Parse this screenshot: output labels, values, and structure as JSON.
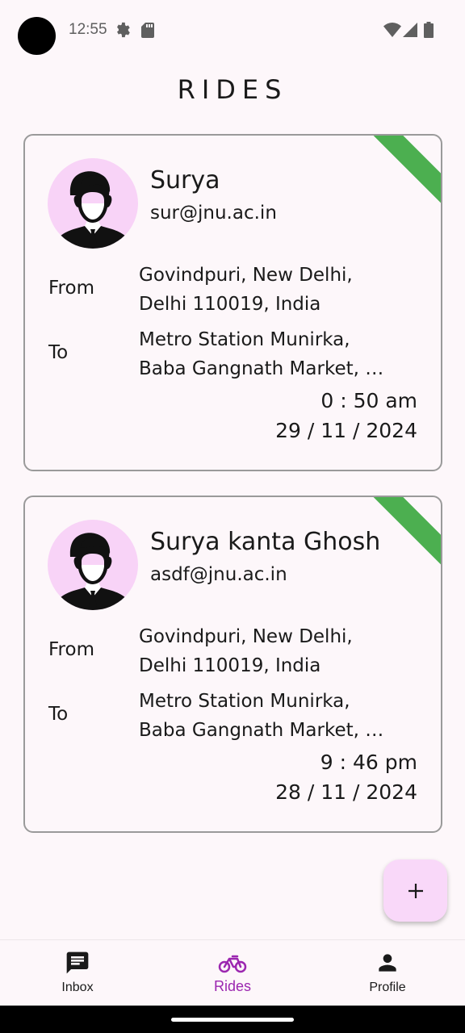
{
  "status_bar": {
    "time": "12:55",
    "icons": [
      "settings-gear-icon",
      "sd-card-icon",
      "wifi-icon",
      "cell-signal-icon",
      "battery-icon"
    ]
  },
  "page": {
    "title": "RIDES"
  },
  "rides": [
    {
      "name": "Surya",
      "email": "sur@jnu.ac.in",
      "from_label": "From",
      "to_label": "To",
      "from_line1": "Govindpuri, New Delhi,",
      "from_line2": "Delhi 110019, India",
      "to_line1": "Metro Station Munirka,",
      "to_line2": "Baba Gangnath Market, …",
      "time": "0 : 50 am",
      "date": "29 / 11 / 2024",
      "ribbon_color": "#4caf50"
    },
    {
      "name": "Surya kanta Ghosh",
      "email": "asdf@jnu.ac.in",
      "from_label": "From",
      "to_label": "To",
      "from_line1": "Govindpuri, New Delhi,",
      "from_line2": "Delhi 110019, India",
      "to_line1": "Metro Station Munirka,",
      "to_line2": "Baba Gangnath Market, …",
      "time": "9 : 46 pm",
      "date": "28 / 11 / 2024",
      "ribbon_color": "#4caf50"
    }
  ],
  "fab": {
    "icon": "plus-icon"
  },
  "bottom_nav": {
    "items": [
      {
        "label": "Inbox",
        "icon": "chat-message-icon",
        "active": false
      },
      {
        "label": "Rides",
        "icon": "bicycle-icon",
        "active": true
      },
      {
        "label": "Profile",
        "icon": "person-icon",
        "active": false
      }
    ]
  },
  "colors": {
    "background": "#fdf7fa",
    "accent": "#9c27b0",
    "avatar_bg": "#f8d3f7",
    "fab_bg": "#f9d8f9",
    "ribbon": "#4caf50"
  }
}
